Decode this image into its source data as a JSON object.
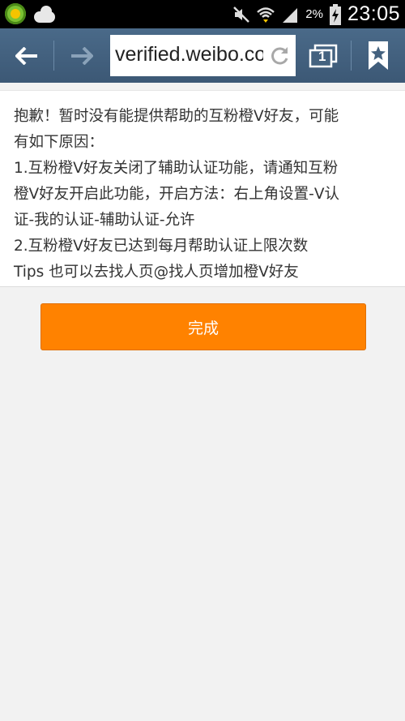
{
  "status_bar": {
    "battery_percent": "2%",
    "time": "23:05",
    "icons": [
      "app-icon-1",
      "weather-cloud-icon",
      "mute-icon",
      "wifi-icon",
      "signal-icon",
      "battery-charging-icon"
    ]
  },
  "browser": {
    "url": "verified.weibo.com",
    "tab_count": "1",
    "icons": [
      "back-arrow-icon",
      "forward-arrow-icon",
      "reload-icon",
      "tabs-icon",
      "bookmark-star-icon"
    ]
  },
  "message": {
    "lines": [
      "抱歉！暂时没有能提供帮助的互粉橙V好友，可能",
      "有如下原因：",
      "1.互粉橙V好友关闭了辅助认证功能，请通知互粉",
      "橙V好友开启此功能，开启方法：右上角设置-V认",
      "证-我的认证-辅助认证-允许",
      "2.互粉橙V好友已达到每月帮助认证上限次数",
      "Tips 也可以去找人页@找人页增加橙V好友"
    ]
  },
  "done_button": {
    "label": "完成"
  },
  "colors": {
    "accent": "#ff8200",
    "toolbar": "#44627f"
  }
}
